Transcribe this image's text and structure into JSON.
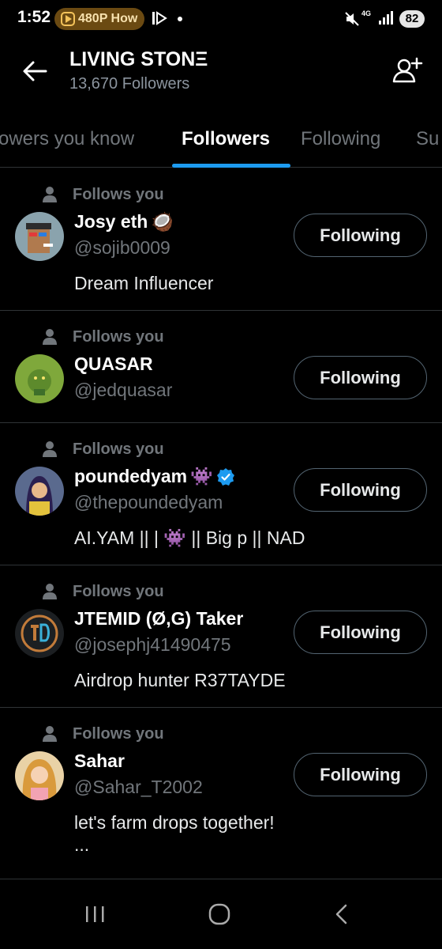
{
  "status_bar": {
    "time": "1:52",
    "pill_text": "480P How",
    "network": "4G",
    "battery": "82",
    "icons": [
      "video-icon",
      "play-icon",
      "dot-icon",
      "mute-icon",
      "signal-icon",
      "battery-icon"
    ]
  },
  "header": {
    "title": "LIVING STONΞ",
    "subtitle": "13,670 Followers",
    "back_icon": "back-arrow-icon",
    "add_icon": "add-user-icon"
  },
  "tabs": [
    {
      "label": "owers you know",
      "active": false
    },
    {
      "label": "Followers",
      "active": true
    },
    {
      "label": "Following",
      "active": false
    },
    {
      "label": "Su",
      "active": false
    }
  ],
  "followers": [
    {
      "follows_you": "Follows you",
      "name": "Josy eth",
      "emoji": "🥥",
      "handle": "@sojib0009",
      "bio": "Dream Influencer",
      "button": "Following"
    },
    {
      "follows_you": "Follows you",
      "name": "QUASAR",
      "handle": "@jedquasar",
      "button": "Following"
    },
    {
      "follows_you": "Follows you",
      "name": "poundedyam",
      "emoji": "👾",
      "verified": true,
      "handle": "@thepoundedyam",
      "bio": "AI.YAM || | 👾 || Big p || NAD",
      "button": "Following"
    },
    {
      "follows_you": "Follows you",
      "name": "JTEMID (Ø,G) Taker",
      "handle": "@josephj41490475",
      "bio": "Airdrop hunter R37TAYDE",
      "button": "Following"
    },
    {
      "follows_you": "Follows you",
      "name": "Sahar",
      "handle": "@Sahar_T2002",
      "bio": "let's farm drops together!",
      "bio_more": "...",
      "button": "Following"
    }
  ],
  "nav": {
    "recents_icon": "recents-icon",
    "home_icon": "home-icon",
    "back_icon": "back-icon"
  },
  "colors": {
    "background": "#000000",
    "accent": "#1d9bf0",
    "muted_text": "#71767b",
    "divider": "#2f3336"
  }
}
